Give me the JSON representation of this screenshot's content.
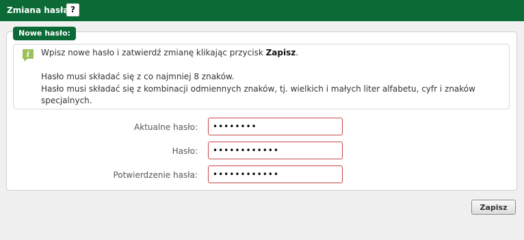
{
  "header": {
    "title": "Zmiana hasła",
    "help_label": "?"
  },
  "panel": {
    "title": "Nowe hasło:"
  },
  "info": {
    "icon": "info-icon",
    "line1_prefix": "Wpisz nowe hasło i zatwierdź zmianę klikając przycisk ",
    "line1_bold": "Zapisz",
    "line1_suffix": ".",
    "line2": "Hasło musi składać się z co najmniej 8 znaków.",
    "line3": "Hasło musi składać się z kombinacji odmiennych znaków, tj. wielkich i małych liter alfabetu, cyfr i znaków",
    "line4": "specjalnych."
  },
  "form": {
    "current_label": "Aktualne hasło:",
    "current_value": "xxxxxxxx",
    "new_label": "Hasło:",
    "new_value": "xxxxxxxxxxxx",
    "confirm_label": "Potwierdzenie hasła:",
    "confirm_value": "xxxxxxxxxxxx"
  },
  "actions": {
    "save_label": "Zapisz"
  },
  "colors": {
    "header_green": "#0b6a36",
    "input_border_error": "#c94545",
    "info_icon_green": "#9cc15b"
  }
}
